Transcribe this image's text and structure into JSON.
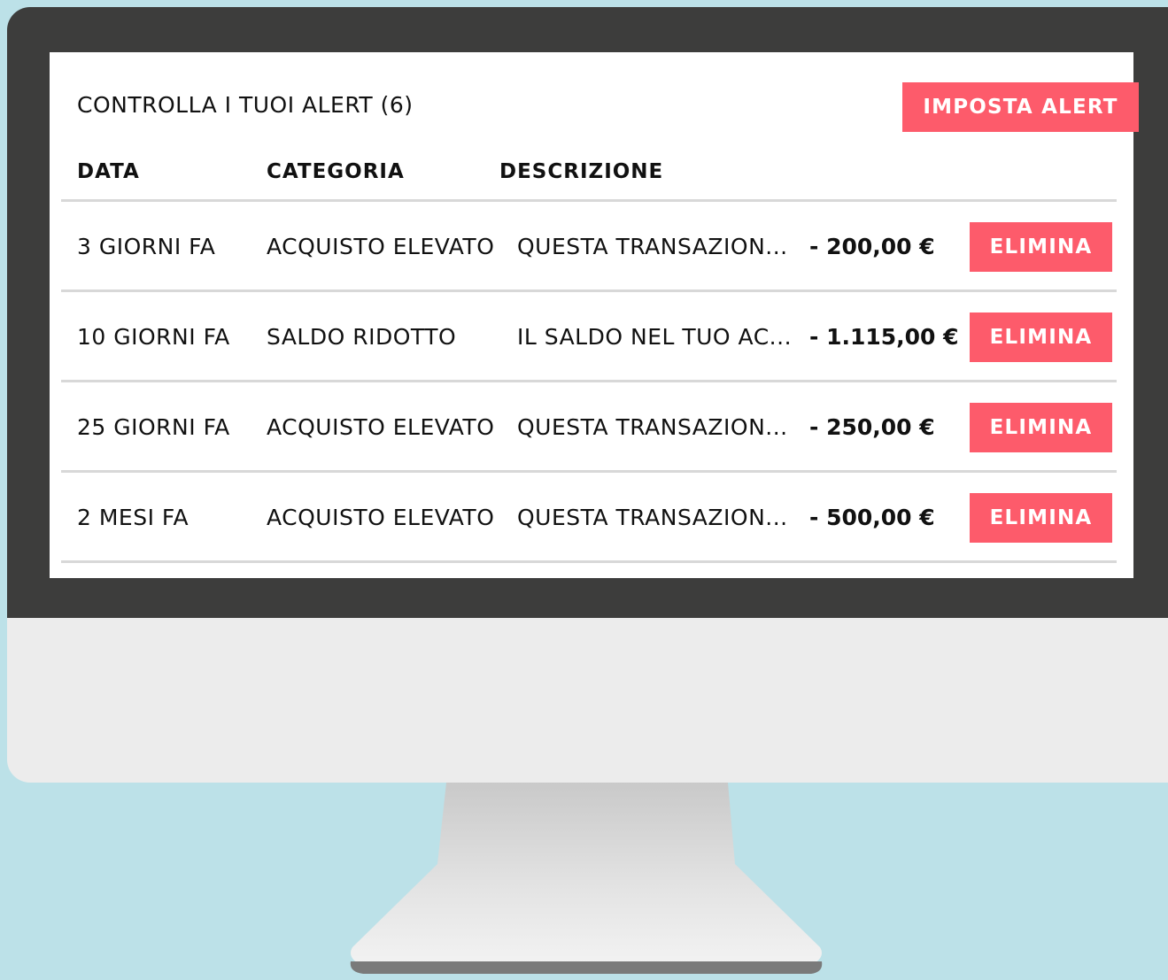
{
  "colors": {
    "background": "#bce1e8",
    "bezel": "#3d3d3c",
    "chin": "#ececec",
    "accent": "#fd5b6b"
  },
  "header": {
    "title": "CONTROLLA I TUOI ALERT (6)",
    "set_alert_label": "IMPOSTA ALERT"
  },
  "table": {
    "columns": [
      "DATA",
      "CATEGORIA",
      "DESCRIZIONE"
    ],
    "rows": [
      {
        "date": "3 GIORNI FA",
        "category": "ACQUISTO ELEVATO",
        "description": "QUESTA TRANSAZION...",
        "amount": "- 200,00 €",
        "action": "ELIMINA"
      },
      {
        "date": "10 GIORNI FA",
        "category": "SALDO RIDOTTO",
        "description": "IL SALDO NEL TUO AC...",
        "amount": "- 1.115,00 €",
        "action": "ELIMINA"
      },
      {
        "date": "25 GIORNI FA",
        "category": "ACQUISTO ELEVATO",
        "description": "QUESTA TRANSAZION...",
        "amount": "- 250,00 €",
        "action": "ELIMINA"
      },
      {
        "date": "2 MESI FA",
        "category": "ACQUISTO ELEVATO",
        "description": "QUESTA TRANSAZION...",
        "amount": "- 500,00 €",
        "action": "ELIMINA"
      }
    ]
  }
}
